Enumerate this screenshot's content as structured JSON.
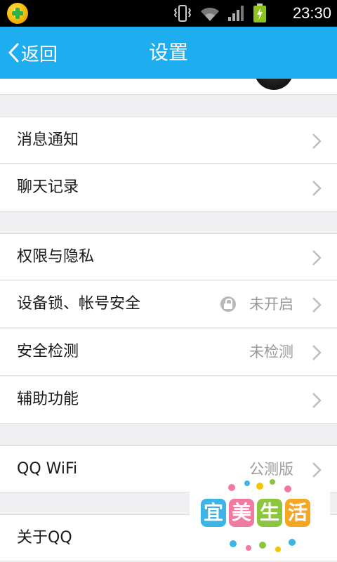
{
  "status_bar": {
    "time": "23:30",
    "left_icon": "app-notification-icon",
    "icons": [
      "vibrate-icon",
      "wifi-icon",
      "signal-icon",
      "battery-charging-icon"
    ]
  },
  "nav": {
    "back_label": "返回",
    "title": "设置",
    "color": "#1eaef0"
  },
  "groups": [
    {
      "items": [
        {
          "label": "消息通知",
          "value": ""
        },
        {
          "label": "聊天记录",
          "value": ""
        }
      ]
    },
    {
      "items": [
        {
          "label": "权限与隐私",
          "value": ""
        },
        {
          "label": "设备锁、帐号安全",
          "value": "未开启",
          "icon": "lock-icon"
        },
        {
          "label": "安全检测",
          "value": "未检测"
        },
        {
          "label": "辅助功能",
          "value": ""
        }
      ]
    },
    {
      "items": [
        {
          "label": "QQ WiFi",
          "value": "公测版"
        }
      ]
    },
    {
      "items": [
        {
          "label": "关于QQ",
          "value": ""
        }
      ]
    }
  ],
  "watermark": {
    "text": [
      "宜",
      "美",
      "生",
      "活"
    ]
  }
}
